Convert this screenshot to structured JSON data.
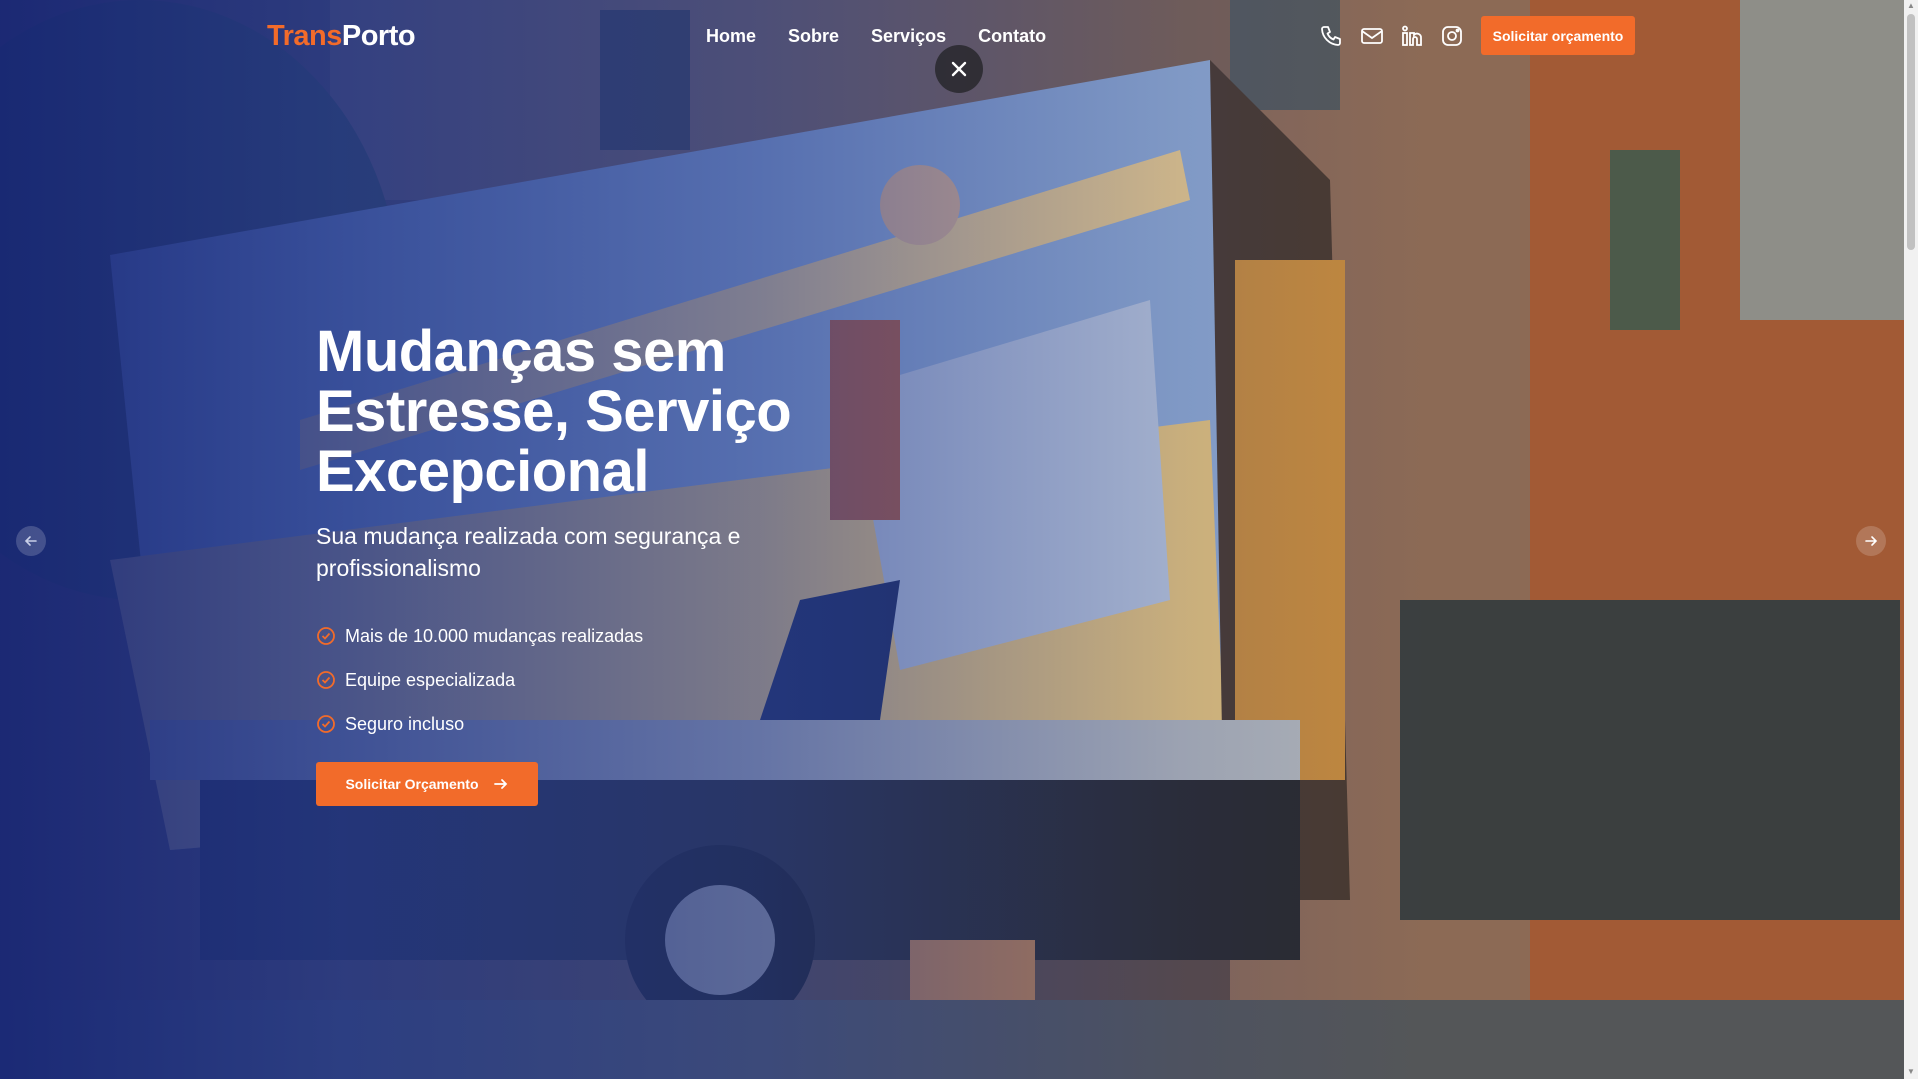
{
  "brand": {
    "part1": "Trans",
    "part2": "Porto"
  },
  "nav": {
    "items": [
      "Home",
      "Sobre",
      "Serviços",
      "Contato"
    ]
  },
  "header": {
    "icons": [
      "phone-icon",
      "mail-icon",
      "linkedin-icon",
      "instagram-icon"
    ],
    "cta_label": "Solicitar orçamento"
  },
  "hero": {
    "title": "Mudanças sem Estresse, Serviço Excepcional",
    "subtitle": "Sua mudança realizada com segurança e profissionalismo",
    "features": [
      "Mais de 10.000 mudanças realizadas",
      "Equipe especializada",
      "Seguro incluso"
    ],
    "cta_label": "Solicitar Orçamento"
  },
  "colors": {
    "accent": "#f26b2a",
    "overlay": "#1f3590",
    "text": "#ffffff"
  }
}
